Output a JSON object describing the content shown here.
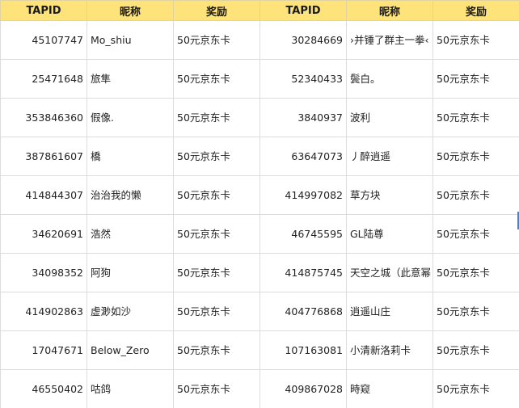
{
  "headers": [
    "TAPID",
    "昵称",
    "奖励",
    "TAPID",
    "昵称",
    "奖励"
  ],
  "rows": [
    {
      "left": {
        "id": "45107747",
        "nick": "Mo_shiu",
        "reward": "50元京东卡"
      },
      "right": {
        "id": "30284669",
        "nick": "›并锤了群主一拳‹",
        "reward": "50元京东卡"
      }
    },
    {
      "left": {
        "id": "25471648",
        "nick": "旅隼",
        "reward": "50元京东卡"
      },
      "right": {
        "id": "52340433",
        "nick": "鬓白。",
        "reward": "50元京东卡"
      }
    },
    {
      "left": {
        "id": "353846360",
        "nick": "假像.",
        "reward": "50元京东卡"
      },
      "right": {
        "id": "3840937",
        "nick": "波利",
        "reward": "50元京东卡"
      }
    },
    {
      "left": {
        "id": "387861607",
        "nick": "橋",
        "reward": "50元京东卡"
      },
      "right": {
        "id": "63647073",
        "nick": "丿醉逍遥",
        "reward": "50元京东卡"
      }
    },
    {
      "left": {
        "id": "414844307",
        "nick": "治治我的懒",
        "reward": "50元京东卡"
      },
      "right": {
        "id": "414997082",
        "nick": "草方块",
        "reward": "50元京东卡"
      }
    },
    {
      "left": {
        "id": "34620691",
        "nick": "浩然",
        "reward": "50元京东卡"
      },
      "right": {
        "id": "46745595",
        "nick": "GL陆尊",
        "reward": "50元京东卡"
      }
    },
    {
      "left": {
        "id": "34098352",
        "nick": "阿狗",
        "reward": "50元京东卡"
      },
      "right": {
        "id": "414875745",
        "nick": "天空之城（此意幂",
        "reward": "50元京东卡"
      }
    },
    {
      "left": {
        "id": "414902863",
        "nick": "虚渺如沙",
        "reward": "50元京东卡"
      },
      "right": {
        "id": "404776868",
        "nick": "逍遥山庄",
        "reward": "50元京东卡"
      }
    },
    {
      "left": {
        "id": "17047671",
        "nick": "Below_Zero",
        "reward": "50元京东卡"
      },
      "right": {
        "id": "107163081",
        "nick": "小清新洛莉卡",
        "reward": "50元京东卡"
      }
    },
    {
      "left": {
        "id": "46550402",
        "nick": "咕鸽",
        "reward": "50元京东卡"
      },
      "right": {
        "id": "409867028",
        "nick": "時窥",
        "reward": "50元京东卡"
      }
    }
  ]
}
